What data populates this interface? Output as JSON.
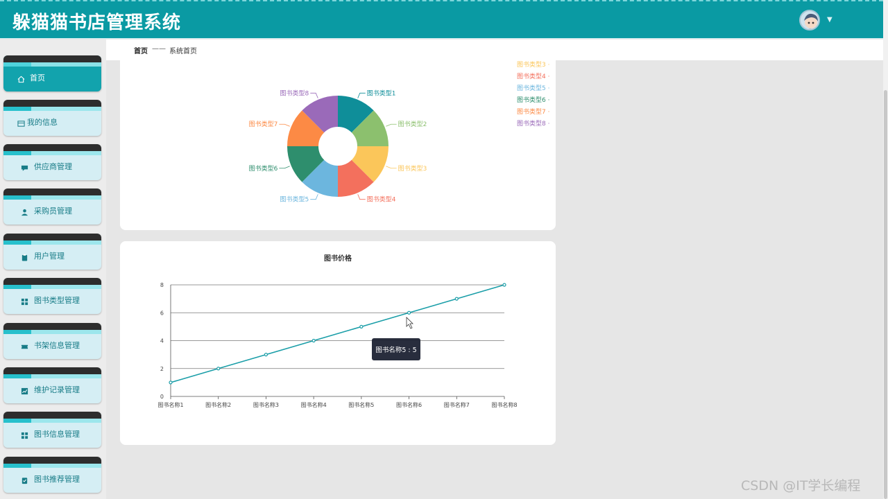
{
  "app": {
    "title": "躲猫猫书店管理系统"
  },
  "sidebar": {
    "items": [
      {
        "label": "首页",
        "icon": "home-icon"
      },
      {
        "label": "我的信息",
        "icon": "profile-card-icon"
      },
      {
        "label": "供应商管理",
        "icon": "chat-icon"
      },
      {
        "label": "采购员管理",
        "icon": "user-icon"
      },
      {
        "label": "用户管理",
        "icon": "clipboard-icon"
      },
      {
        "label": "图书类型管理",
        "icon": "grid-icon"
      },
      {
        "label": "书架信息管理",
        "icon": "ticket-icon"
      },
      {
        "label": "维护记录管理",
        "icon": "chart-icon"
      },
      {
        "label": "图书信息管理",
        "icon": "grid-icon"
      },
      {
        "label": "图书推荐管理",
        "icon": "checklist-icon"
      }
    ],
    "active_index": 0
  },
  "breadcrumb": {
    "home": "首页",
    "separator": "——",
    "current": "系统首页"
  },
  "legend": {
    "items": [
      "图书类型3",
      "图书类型4",
      "图书类型5",
      "图书类型6",
      "图书类型7",
      "图书类型8"
    ]
  },
  "tooltip": {
    "text": "图书名称5 : 5"
  },
  "watermark": "CSDN @IT学长编程",
  "colors": {
    "brand": "#0a9aa3",
    "line": "#1a9ea8",
    "pie": [
      "#0f8e99",
      "#8cc06e",
      "#fbc65a",
      "#f3705d",
      "#6cb6de",
      "#2e8e6d",
      "#fc8a45",
      "#9a6ab9"
    ]
  },
  "chart_data": [
    {
      "type": "pie",
      "title": "",
      "donut": true,
      "categories": [
        "图书类型1",
        "图书类型2",
        "图书类型3",
        "图书类型4",
        "图书类型5",
        "图书类型6",
        "图书类型7",
        "图书类型8"
      ],
      "values": [
        1,
        1,
        1,
        1,
        1,
        1,
        1,
        1
      ],
      "legend": "top-right"
    },
    {
      "type": "line",
      "title": "图书价格",
      "xlabel": "",
      "ylabel": "",
      "categories": [
        "图书名称1",
        "图书名称2",
        "图书名称3",
        "图书名称4",
        "图书名称5",
        "图书名称6",
        "图书名称7",
        "图书名称8"
      ],
      "values": [
        1,
        2,
        3,
        4,
        5,
        6,
        7,
        8
      ],
      "ylim": [
        0,
        8
      ],
      "yticks": [
        0,
        2,
        4,
        6,
        8
      ],
      "grid": true
    }
  ]
}
